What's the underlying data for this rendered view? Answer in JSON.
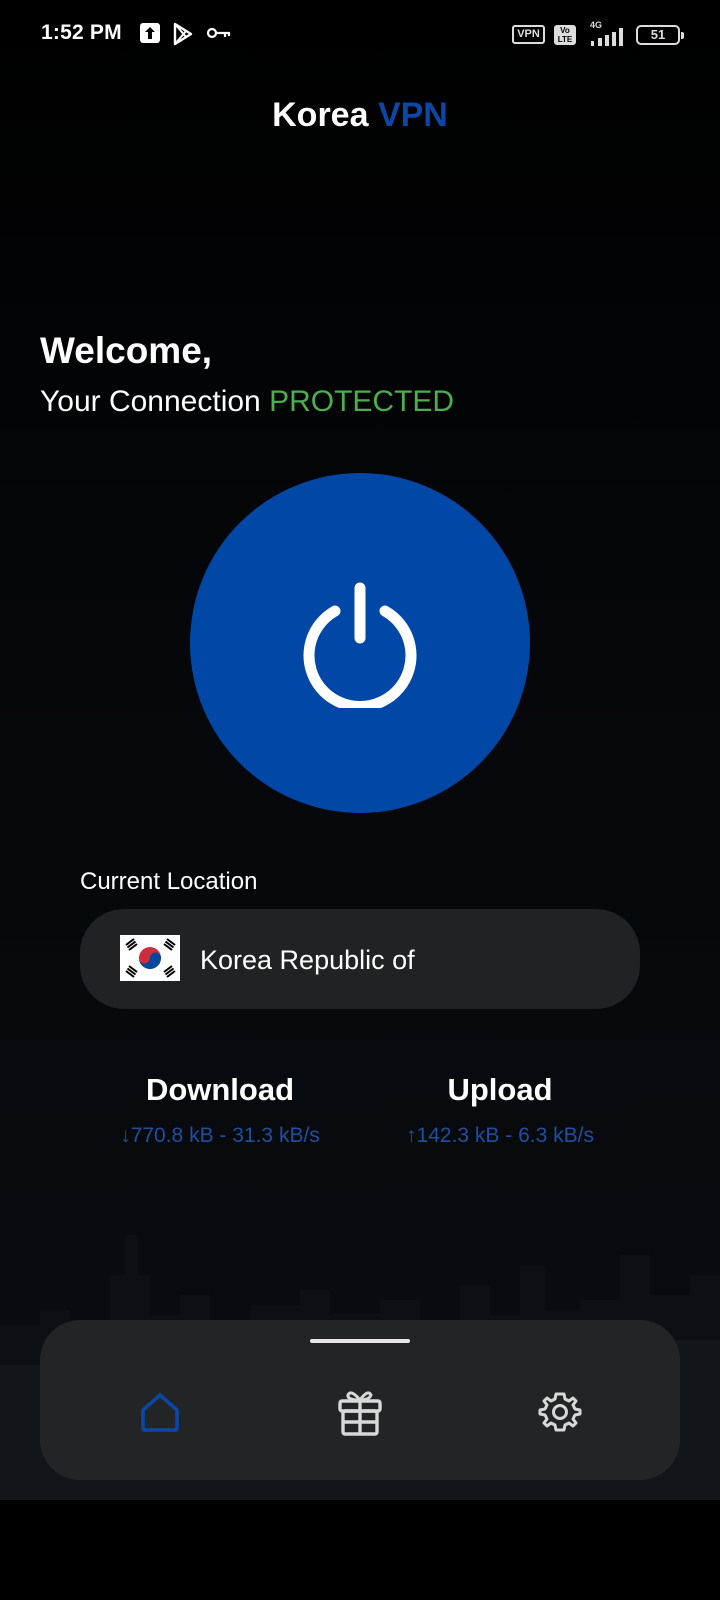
{
  "status_bar": {
    "time": "1:52 PM",
    "vpn_badge": "VPN",
    "volte": "Vo LTE",
    "network": "4G",
    "battery": "51"
  },
  "header": {
    "title_part1": "Korea",
    "title_part2": "VPN"
  },
  "welcome": {
    "greeting": "Welcome,",
    "connection_prefix": "Your Connection",
    "connection_status": "PROTECTED"
  },
  "location": {
    "label": "Current Location",
    "country": "Korea Republic of"
  },
  "stats": {
    "download_title": "Download",
    "download_value": "↓770.8 kB - 31.3 kB/s",
    "upload_title": "Upload",
    "upload_value": "↑142.3 kB - 6.3 kB/s"
  },
  "nav": {
    "items": [
      {
        "icon": "home-icon",
        "active": true
      },
      {
        "icon": "gift-icon",
        "active": false
      },
      {
        "icon": "settings-gear-icon",
        "active": false
      }
    ]
  },
  "colors": {
    "accent": "#0047a6",
    "protected": "#4cae4f",
    "stat_text": "#1f4fa0",
    "card": "#212223"
  }
}
